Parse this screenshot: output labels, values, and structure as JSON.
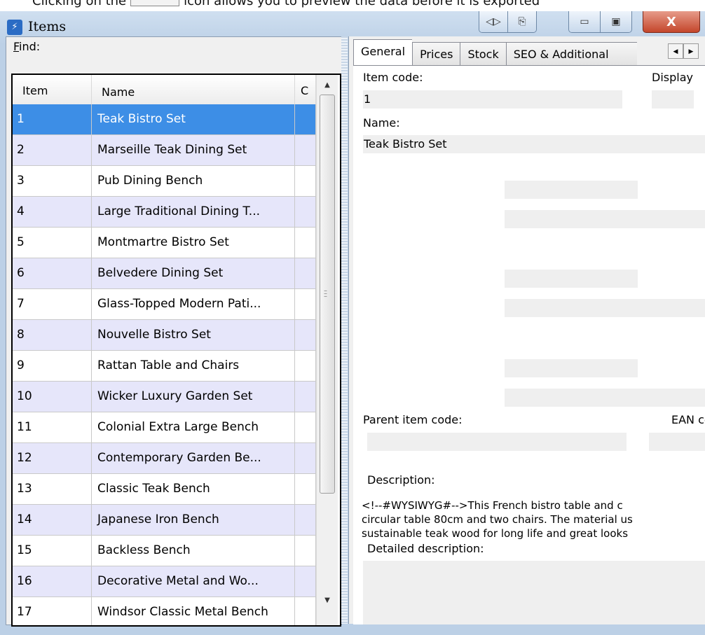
{
  "caption": {
    "before": "Clicking on the",
    "after": "icon allows you to preview the data before it is exported"
  },
  "window": {
    "title": "Items",
    "close_glyph": "X",
    "buttons": [
      "navigate-icon",
      "export-icon",
      "minimize-icon",
      "maximize-icon",
      "close-icon"
    ]
  },
  "find": {
    "label_hot": "F",
    "label_rest": "ind:"
  },
  "grid": {
    "columns": [
      "Item",
      "Name",
      "C"
    ],
    "rows": [
      {
        "item": "1",
        "name": "Teak Bistro Set"
      },
      {
        "item": "2",
        "name": "Marseille Teak Dining Set"
      },
      {
        "item": "3",
        "name": "Pub Dining Bench"
      },
      {
        "item": "4",
        "name": "Large Traditional Dining T..."
      },
      {
        "item": "5",
        "name": "Montmartre Bistro Set"
      },
      {
        "item": "6",
        "name": "Belvedere Dining Set"
      },
      {
        "item": "7",
        "name": "Glass-Topped Modern Pati..."
      },
      {
        "item": "8",
        "name": "Nouvelle Bistro Set"
      },
      {
        "item": "9",
        "name": "Rattan Table and Chairs"
      },
      {
        "item": "10",
        "name": "Wicker Luxury Garden Set"
      },
      {
        "item": "11",
        "name": "Colonial Extra Large Bench"
      },
      {
        "item": "12",
        "name": "Contemporary Garden Be..."
      },
      {
        "item": "13",
        "name": "Classic Teak Bench"
      },
      {
        "item": "14",
        "name": "Japanese Iron Bench"
      },
      {
        "item": "15",
        "name": "Backless Bench"
      },
      {
        "item": "16",
        "name": "Decorative Metal and Wo..."
      },
      {
        "item": "17",
        "name": "Windsor Classic Metal Bench"
      }
    ],
    "selected_item": "1"
  },
  "tabs": [
    "General",
    "Prices",
    "Stock",
    "SEO & Additional"
  ],
  "detail": {
    "item_code_label": "Item code:",
    "item_code_value": "1",
    "display_label": "Display",
    "name_label": "Name:",
    "name_value": "Teak Bistro Set",
    "parent_label": "Parent item code:",
    "ean_label": "EAN co",
    "description_label": "Description:",
    "description_lines": [
      "<!--#WYSIWYG#-->This French bistro table and c",
      "circular table 80cm and two chairs. The material us",
      "sustainable teak wood for long life and great looks"
    ],
    "detailed_label": "Detailed description:"
  },
  "colors": {
    "selection": "#3d8ee6",
    "alt_row": "#e6e6fa",
    "close": "#c4462b"
  }
}
